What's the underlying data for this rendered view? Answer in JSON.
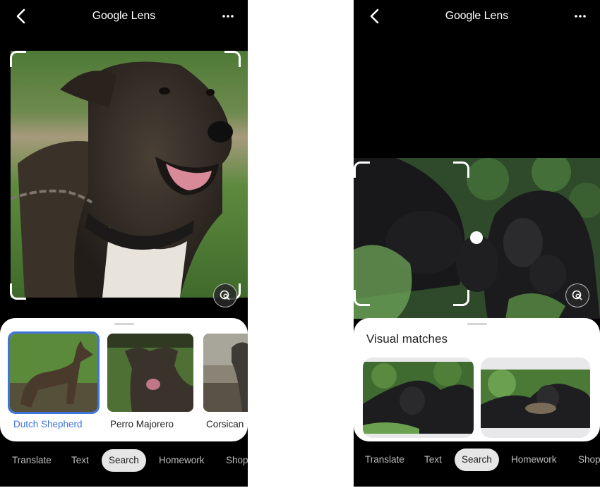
{
  "left_screen": {
    "header": {
      "title_bold": "Google",
      "title_rest": " Lens",
      "back_icon": "chevron-left-icon",
      "more_icon": "more-horizontal-icon"
    },
    "photo": {
      "subject": "dog-photo",
      "lens_button_icon": "lens-search-icon"
    },
    "results": [
      {
        "label": "Dutch Shepherd",
        "selected": true
      },
      {
        "label": "Perro Majorero",
        "selected": false
      },
      {
        "label": "Corsican",
        "selected": false
      }
    ],
    "tabs": [
      {
        "label": "Translate",
        "active": false
      },
      {
        "label": "Text",
        "active": false
      },
      {
        "label": "Search",
        "active": true
      },
      {
        "label": "Homework",
        "active": false
      },
      {
        "label": "Shop",
        "active": false
      }
    ]
  },
  "right_screen": {
    "header": {
      "title_bold": "Google",
      "title_rest": " Lens",
      "back_icon": "chevron-left-icon",
      "more_icon": "more-horizontal-icon"
    },
    "photo": {
      "subject": "gorilla-photo",
      "lens_button_icon": "lens-search-icon"
    },
    "visual_matches_title": "Visual matches",
    "matches": [
      {
        "subject": "gorilla-family"
      },
      {
        "subject": "baby-gorilla"
      }
    ],
    "tabs": [
      {
        "label": "Translate",
        "active": false
      },
      {
        "label": "Text",
        "active": false
      },
      {
        "label": "Search",
        "active": true
      },
      {
        "label": "Homework",
        "active": false
      },
      {
        "label": "Shop",
        "active": false
      }
    ]
  },
  "colors": {
    "accent": "#3f74dc",
    "background": "#000000",
    "sheet": "#ffffff",
    "active_tab": "#e6e6e6"
  }
}
